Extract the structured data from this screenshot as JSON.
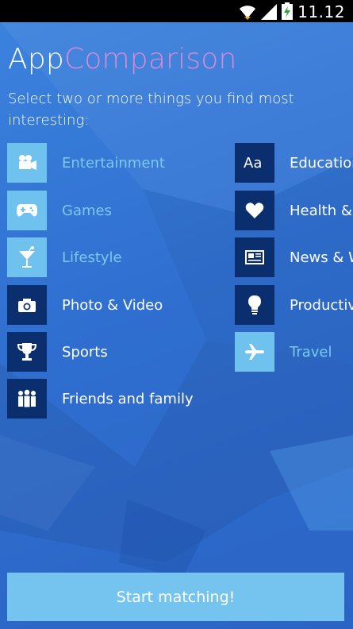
{
  "status_bar": {
    "time": "11.12",
    "icons": [
      "wifi-icon",
      "signal-icon",
      "battery-charging-icon"
    ]
  },
  "header": {
    "title_part1": "App",
    "title_part2": "Comparison",
    "subtitle": "Select two or more things you find most interesting:"
  },
  "categories": [
    {
      "label": "Entertainment",
      "icon": "video-camera-icon",
      "selected": false
    },
    {
      "label": "Education",
      "icon": "font-aa-icon",
      "selected": true
    },
    {
      "label": "Games",
      "icon": "gamepad-icon",
      "selected": false
    },
    {
      "label": "Health &",
      "icon": "heart-icon",
      "selected": true
    },
    {
      "label": "Lifestyle",
      "icon": "cocktail-icon",
      "selected": false
    },
    {
      "label": "News & W",
      "icon": "newspaper-icon",
      "selected": true
    },
    {
      "label": "Photo & Video",
      "icon": "camera-icon",
      "selected": true
    },
    {
      "label": "Productiv",
      "icon": "lightbulb-icon",
      "selected": true
    },
    {
      "label": "Sports",
      "icon": "trophy-icon",
      "selected": true
    },
    {
      "label": "Travel",
      "icon": "airplane-icon",
      "selected": false
    },
    {
      "label": "Friends and family",
      "icon": "people-icon",
      "selected": true
    }
  ],
  "footer": {
    "start_label": "Start matching!"
  },
  "colors": {
    "background": "#2f6fd0",
    "tile_unselected": "#70c2ee",
    "tile_selected": "#0b2f6e",
    "title_accent": "#d98ad7",
    "button": "#74c4ef"
  }
}
